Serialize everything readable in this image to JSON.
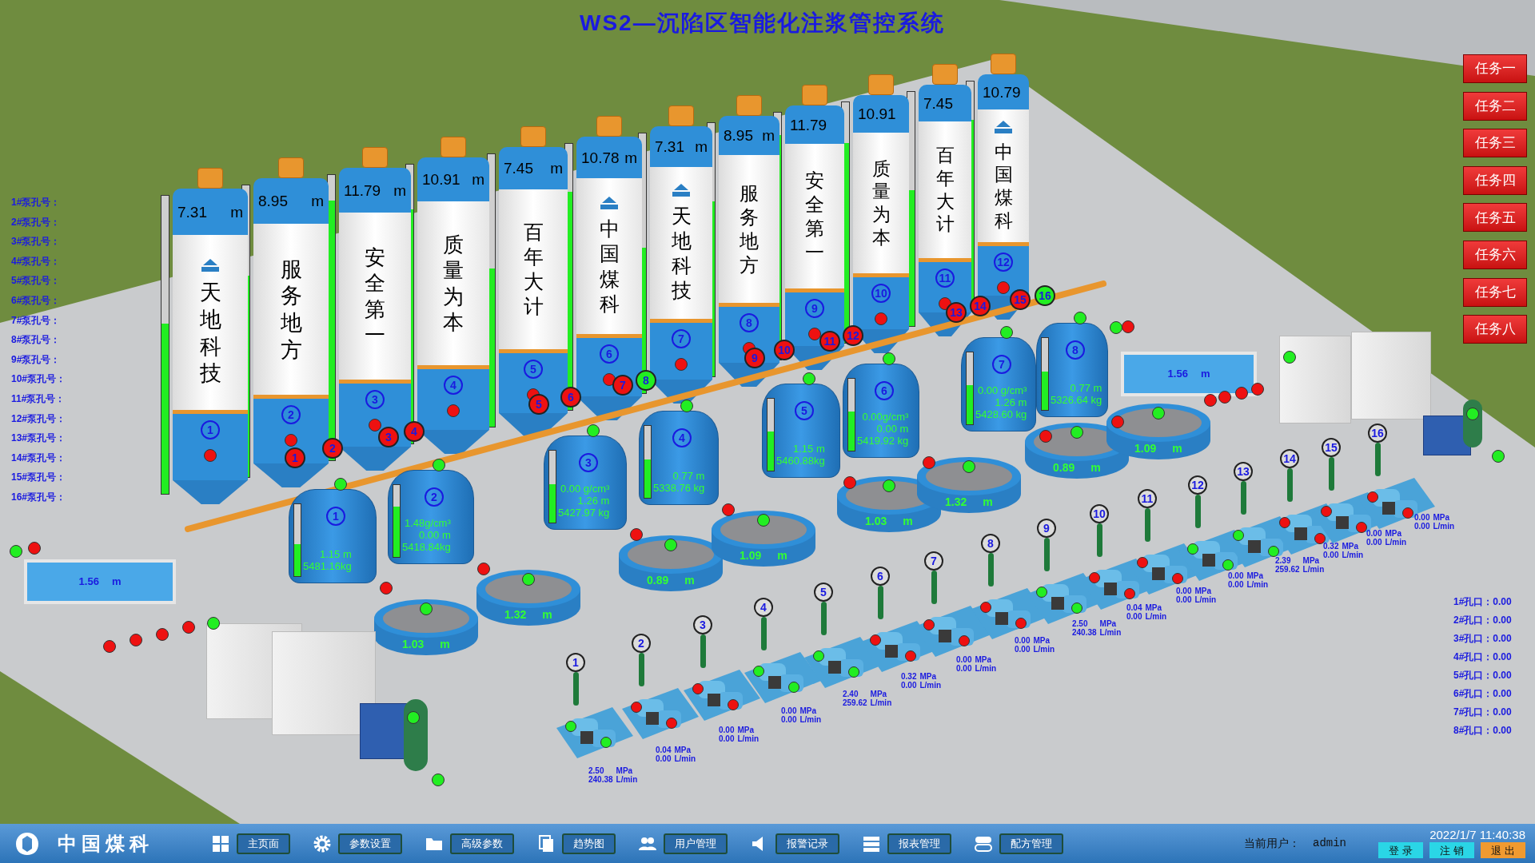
{
  "title": "WS2—沉陷区智能化注浆管控系统",
  "tasks": [
    {
      "label": "任务一"
    },
    {
      "label": "任务二"
    },
    {
      "label": "任务三"
    },
    {
      "label": "任务四"
    },
    {
      "label": "任务五"
    },
    {
      "label": "任务六"
    },
    {
      "label": "任务七"
    },
    {
      "label": "任务八"
    }
  ],
  "pump_hole_labels": [
    "1#泵孔号：",
    "2#泵孔号：",
    "3#泵孔号：",
    "4#泵孔号：",
    "5#泵孔号：",
    "6#泵孔号：",
    "7#泵孔号：",
    "8#泵孔号：",
    "9#泵孔号：",
    "10#泵孔号：",
    "11#泵孔号：",
    "12#泵孔号：",
    "13#泵孔号：",
    "14#泵孔号：",
    "15#泵孔号：",
    "16#泵孔号："
  ],
  "hole_readings": [
    "1#孔口：0.00",
    "2#孔口：0.00",
    "3#孔口：0.00",
    "4#孔口：0.00",
    "5#孔口：0.00",
    "6#孔口：0.00",
    "7#孔口：0.00",
    "8#孔口：0.00"
  ],
  "silos": [
    {
      "number": "1",
      "reading": "7.31",
      "unit": "m",
      "slogan": "天地科技",
      "logo": true,
      "level": 0.57,
      "alarm": true
    },
    {
      "number": "2",
      "reading": "8.95",
      "unit": "m",
      "slogan": "服务地方",
      "logo": false,
      "level": 0.69,
      "alarm": true
    },
    {
      "number": "3",
      "reading": "11.79",
      "unit": "m",
      "slogan": "安全第一",
      "logo": false,
      "level": 0.91,
      "alarm": true
    },
    {
      "number": "4",
      "reading": "10.91",
      "unit": "m",
      "slogan": "质量为本",
      "logo": false,
      "level": 0.84,
      "alarm": true
    },
    {
      "number": "5",
      "reading": "7.45",
      "unit": "m",
      "slogan": "百年大计",
      "logo": false,
      "level": 0.58,
      "alarm": true
    },
    {
      "number": "6",
      "reading": "10.78",
      "unit": "m",
      "slogan": "中国煤科",
      "logo": true,
      "level": 0.82,
      "alarm": true
    },
    {
      "number": "7",
      "reading": "7.31",
      "unit": "m",
      "slogan": "天地科技",
      "logo": true,
      "level": 0.56,
      "alarm": true
    },
    {
      "number": "8",
      "reading": "8.95",
      "unit": "m",
      "slogan": "服务地方",
      "logo": false,
      "level": 0.69,
      "alarm": true
    },
    {
      "number": "9",
      "reading": "11.79",
      "slogan": "安全第一",
      "logo": false,
      "level": 0.91,
      "alarm": true
    },
    {
      "number": "10",
      "reading": "10.91",
      "slogan": "质量为本",
      "logo": false,
      "level": 0.83,
      "alarm": true
    },
    {
      "number": "11",
      "reading": "7.45",
      "slogan": "百年大计",
      "logo": false,
      "level": 0.58,
      "alarm": true
    },
    {
      "number": "12",
      "reading": "10.79",
      "slogan": "中国煤科",
      "logo": true,
      "level": 0.83,
      "alarm": true
    }
  ],
  "valves": [
    {
      "number": "1",
      "open": false
    },
    {
      "number": "2",
      "open": false
    },
    {
      "number": "3",
      "open": false
    },
    {
      "number": "4",
      "open": false
    },
    {
      "number": "5",
      "open": false
    },
    {
      "number": "6",
      "open": false
    },
    {
      "number": "7",
      "open": false
    },
    {
      "number": "8",
      "open": true
    },
    {
      "number": "9",
      "open": false
    },
    {
      "number": "10",
      "open": false
    },
    {
      "number": "11",
      "open": false
    },
    {
      "number": "12",
      "open": false
    },
    {
      "number": "13",
      "open": false
    },
    {
      "number": "14",
      "open": false
    },
    {
      "number": "15",
      "open": false
    },
    {
      "number": "16",
      "open": true
    }
  ],
  "mixers": [
    {
      "number": "1",
      "readings": [
        "1.15 m",
        "5481.16kg"
      ],
      "level": 0.45,
      "agitator_on": true,
      "discharge_on": false
    },
    {
      "number": "2",
      "readings": [
        "1.48g/cm³",
        "0.00 m",
        "5418.84kg"
      ],
      "level": 0.7,
      "agitator_on": true,
      "discharge_on": false
    },
    {
      "number": "3",
      "readings": [
        "0.00 g/cm³",
        "1.26 m",
        "5427.97 kg"
      ],
      "level": 0.53,
      "agitator_on": true,
      "discharge_on": false
    },
    {
      "number": "4",
      "readings": [
        "0.77 m",
        "5338.76 kg"
      ],
      "level": 0.53,
      "agitator_on": true,
      "discharge_on": false
    },
    {
      "number": "5",
      "readings": [
        "1.15 m",
        "5460.88kg"
      ],
      "level": 0.55,
      "agitator_on": true,
      "discharge_on": false
    },
    {
      "number": "6",
      "readings": [
        "0.00g/cm³",
        "0.00 m",
        "5419.92 kg"
      ],
      "level": 0.55,
      "agitator_on": true,
      "discharge_on": false
    },
    {
      "number": "7",
      "readings": [
        "0.00 g/cm³",
        "1.26 m",
        "5428.60 kg"
      ],
      "level": 0.55,
      "agitator_on": true,
      "discharge_on": false
    },
    {
      "number": "8",
      "readings": [
        "0.77 m",
        "5326.64 kg"
      ],
      "level": 0.53,
      "agitator_on": true,
      "discharge_on": false
    }
  ],
  "pools": [
    {
      "reading": "1.03",
      "unit": "m",
      "pump_on": true
    },
    {
      "reading": "1.32",
      "unit": "m",
      "pump_on": true
    },
    {
      "reading": "0.89",
      "unit": "m",
      "pump_on": true
    },
    {
      "reading": "1.09",
      "unit": "m",
      "pump_on": true
    },
    {
      "reading": "1.03",
      "unit": "m",
      "pump_on": true
    },
    {
      "reading": "1.32",
      "unit": "m",
      "pump_on": true
    },
    {
      "reading": "0.89",
      "unit": "m",
      "pump_on": true
    },
    {
      "reading": "1.09",
      "unit": "m",
      "pump_on": true
    }
  ],
  "water_tanks": [
    {
      "reading": "1.56",
      "unit": "m"
    },
    {
      "reading": "1.56",
      "unit": "m"
    }
  ],
  "pumps": [
    {
      "number": "1",
      "pressure": "2.50",
      "pressure_unit": "MPa",
      "flow": "240.38",
      "flow_unit": "L/min",
      "running": true
    },
    {
      "number": "2",
      "pressure": "0.04",
      "pressure_unit": "MPa",
      "flow": "0.00",
      "flow_unit": "L/min",
      "running": false
    },
    {
      "number": "3",
      "pressure": "0.00",
      "pressure_unit": "MPa",
      "flow": "0.00",
      "flow_unit": "L/min",
      "running": false
    },
    {
      "number": "4",
      "pressure": "0.00",
      "pressure_unit": "MPa",
      "flow": "0.00",
      "flow_unit": "L/min",
      "running": true
    },
    {
      "number": "5",
      "pressure": "2.40",
      "pressure_unit": "MPa",
      "flow": "259.62",
      "flow_unit": "L/min",
      "running": true
    },
    {
      "number": "6",
      "pressure": "0.32",
      "pressure_unit": "MPa",
      "flow": "0.00",
      "flow_unit": "L/min",
      "running": false
    },
    {
      "number": "7",
      "pressure": "0.00",
      "pressure_unit": "MPa",
      "flow": "0.00",
      "flow_unit": "L/min",
      "running": false
    },
    {
      "number": "8",
      "pressure": "0.00",
      "pressure_unit": "MPa",
      "flow": "0.00",
      "flow_unit": "L/min",
      "running": false
    },
    {
      "number": "9",
      "pressure": "2.50",
      "pressure_unit": "MPa",
      "flow": "240.38",
      "flow_unit": "L/min",
      "running": true
    },
    {
      "number": "10",
      "pressure": "0.04",
      "pressure_unit": "MPa",
      "flow": "0.00",
      "flow_unit": "L/min",
      "running": false
    },
    {
      "number": "11",
      "pressure": "0.00",
      "pressure_unit": "MPa",
      "flow": "0.00",
      "flow_unit": "L/min",
      "running": false
    },
    {
      "number": "12",
      "pressure": "0.00",
      "pressure_unit": "MPa",
      "flow": "0.00",
      "flow_unit": "L/min",
      "running": true
    },
    {
      "number": "13",
      "pressure": "2.39",
      "pressure_unit": "MPa",
      "flow": "259.62",
      "flow_unit": "L/min",
      "running": true
    },
    {
      "number": "14",
      "pressure": "0.32",
      "pressure_unit": "MPa",
      "flow": "0.00",
      "flow_unit": "L/min",
      "running": false
    },
    {
      "number": "15",
      "pressure": "0.00",
      "pressure_unit": "MPa",
      "flow": "0.00",
      "flow_unit": "L/min",
      "running": false
    },
    {
      "number": "16",
      "pressure": "0.00",
      "pressure_unit": "MPa",
      "flow": "0.00",
      "flow_unit": "L/min",
      "running": false
    }
  ],
  "aux_indicators": [
    {
      "on": true
    },
    {
      "on": false
    },
    {
      "on": false
    },
    {
      "on": false
    },
    {
      "on": false
    },
    {
      "on": false
    },
    {
      "on": true
    },
    {
      "on": true
    },
    {
      "on": true
    },
    {
      "on": true
    },
    {
      "on": false
    },
    {
      "on": false
    },
    {
      "on": false
    },
    {
      "on": false
    },
    {
      "on": false
    },
    {
      "on": true
    },
    {
      "on": true
    },
    {
      "on": true
    }
  ],
  "taskbar": {
    "brand": "中国煤科",
    "nav": [
      {
        "label": "主页面",
        "kind": "home"
      },
      {
        "label": "参数设置",
        "kind": "settings"
      },
      {
        "label": "高级参数",
        "kind": "folder"
      },
      {
        "label": "趋势图",
        "kind": "trend"
      },
      {
        "label": "用户管理",
        "kind": "users"
      },
      {
        "label": "报警记录",
        "kind": "alarm"
      },
      {
        "label": "报表管理",
        "kind": "report"
      },
      {
        "label": "配方管理",
        "kind": "recipe"
      }
    ],
    "user_label": "当前用户：",
    "user": "admin",
    "actions": [
      {
        "label": "登 录",
        "kind": "login"
      },
      {
        "label": "注 销",
        "kind": "logout"
      },
      {
        "label": "退 出",
        "kind": "exit"
      }
    ],
    "datetime": "2022/1/7 11:40:38"
  }
}
